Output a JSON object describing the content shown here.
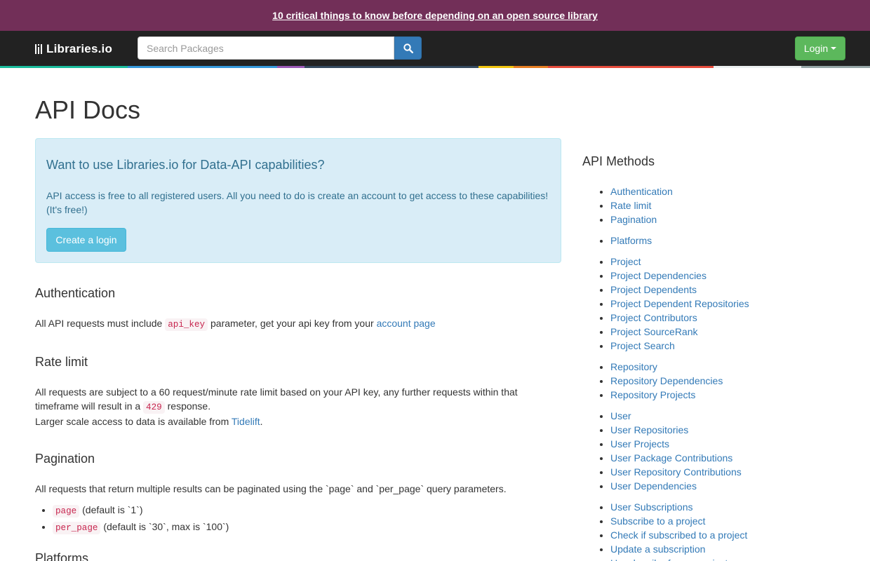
{
  "banner": {
    "text": "10 critical things to know before depending on an open source library"
  },
  "navbar": {
    "logo_text": "Libraries.io",
    "search_placeholder": "Search Packages",
    "login_label": "Login"
  },
  "colorbar": [
    "#1abc9c",
    "#3498db",
    "#9b59b6",
    "#34495e",
    "#f1c40f",
    "#e67e22",
    "#e74c3c",
    "#ecf0f1",
    "#95a5a6"
  ],
  "page": {
    "title": "API Docs"
  },
  "cta": {
    "heading": "Want to use Libraries.io for Data-API capabilities?",
    "text": "API access is free to all registered users. All you need to do is create an account to get access to these capabilities! (It's free!)",
    "button": "Create a login"
  },
  "auth": {
    "heading": "Authentication",
    "text_before": "All API requests must include ",
    "code": "api_key",
    "text_after": " parameter, get your api key from your ",
    "link": "account page"
  },
  "rate": {
    "heading": "Rate limit",
    "text_before": "All requests are subject to a 60 request/minute rate limit based on your API key, any further requests within that timeframe will result in a ",
    "code": "429",
    "text_after": " response.",
    "line2_before": "Larger scale access to data is available from ",
    "line2_link": "Tidelift",
    "line2_after": "."
  },
  "pagination": {
    "heading": "Pagination",
    "text": "All requests that return multiple results can be paginated using the `page` and `per_page` query parameters.",
    "items": [
      {
        "code": "page",
        "desc": " (default is `1`)"
      },
      {
        "code": "per_page",
        "desc": " (default is `30`, max is `100`)"
      }
    ]
  },
  "next_heading": "Platforms",
  "sidebar": {
    "heading": "API Methods",
    "groups": [
      [
        "Authentication",
        "Rate limit",
        "Pagination"
      ],
      [
        "Platforms"
      ],
      [
        "Project",
        "Project Dependencies",
        "Project Dependents",
        "Project Dependent Repositories",
        "Project Contributors",
        "Project SourceRank",
        "Project Search"
      ],
      [
        "Repository",
        "Repository Dependencies",
        "Repository Projects"
      ],
      [
        "User",
        "User Repositories",
        "User Projects",
        "User Package Contributions",
        "User Repository Contributions",
        "User Dependencies"
      ],
      [
        "User Subscriptions",
        "Subscribe to a project",
        "Check if subscribed to a project",
        "Update a subscription",
        "Unsubscribe from a project"
      ]
    ]
  }
}
